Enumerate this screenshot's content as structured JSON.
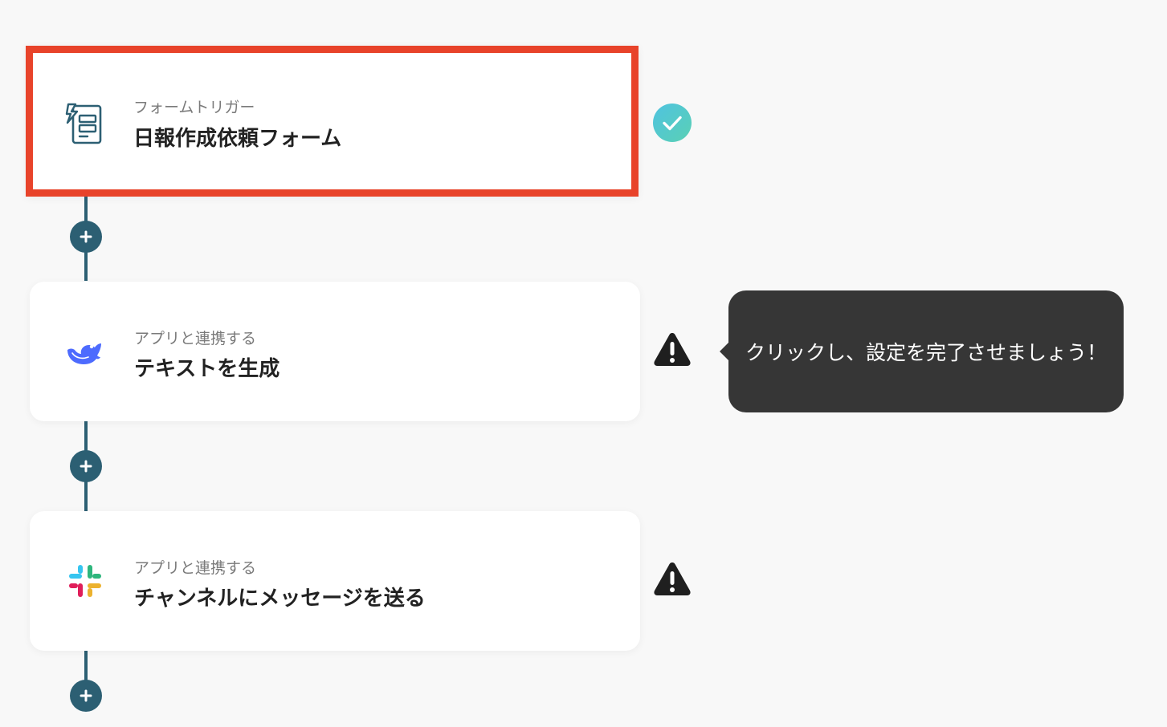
{
  "flow": {
    "steps": [
      {
        "kind": "フォームトリガー",
        "title": "日報作成依頼フォーム",
        "icon": "form-trigger-icon",
        "status": "complete",
        "selected": true
      },
      {
        "kind": "アプリと連携する",
        "title": "テキストを生成",
        "icon": "deepseek-whale-icon",
        "status": "warning",
        "selected": false
      },
      {
        "kind": "アプリと連携する",
        "title": "チャンネルにメッセージを送る",
        "icon": "slack-icon",
        "status": "warning",
        "selected": false
      }
    ]
  },
  "tooltip": {
    "text": "クリックし、設定を完了させましょう！"
  },
  "colors": {
    "background": "#f8f8f8",
    "connector": "#2c5f73",
    "selected_border": "#e8432a",
    "check_start": "#4fc3e0",
    "check_end": "#5ad0b4",
    "warning": "#1f1f1f",
    "tooltip_bg": "#363636"
  }
}
